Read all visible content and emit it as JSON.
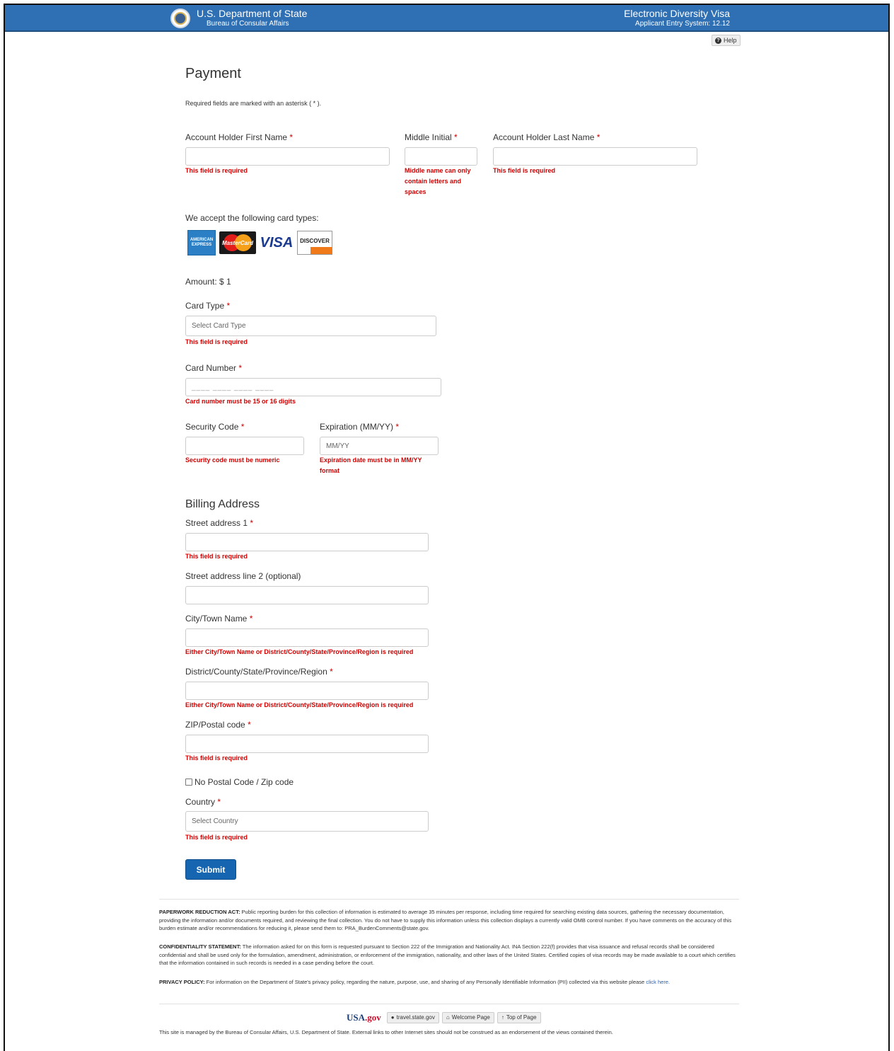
{
  "header": {
    "department": "U.S. Department of State",
    "bureau": "Bureau of Consular Affairs",
    "system_name": "Electronic Diversity Visa",
    "system_version": "Applicant Entry System: 12.12",
    "help_label": "Help"
  },
  "page": {
    "title": "Payment",
    "required_note": "Required fields are marked with an asterisk ( * )."
  },
  "name_fields": {
    "first_name_label": "Account Holder First Name",
    "first_name_error": "This field is required",
    "middle_initial_label": "Middle Initial",
    "middle_initial_error": "Middle name can only contain letters and spaces",
    "last_name_label": "Account Holder Last Name",
    "last_name_error": "This field is required"
  },
  "cards": {
    "accept_label": "We accept the following card types:",
    "amex_label": "AMERICAN EXPRESS",
    "mastercard_label": "MasterCard",
    "visa_label": "VISA",
    "discover_label": "DISCOVER"
  },
  "payment": {
    "amount": "Amount: $ 1",
    "card_type_label": "Card Type",
    "card_type_value": "Select Card Type",
    "card_type_error": "This field is required",
    "card_number_label": "Card Number",
    "card_number_mask": "____ ____ ____ ____",
    "card_number_error": "Card number must be 15 or 16 digits",
    "security_code_label": "Security Code",
    "security_code_error": "Security code must be numeric",
    "expiration_label": "Expiration (MM/YY)",
    "expiration_placeholder": "MM/YY",
    "expiration_error": "Expiration date must be in MM/YY format"
  },
  "billing": {
    "title": "Billing Address",
    "street1_label": "Street address 1",
    "street1_error": "This field is required",
    "street2_label": "Street address line 2 (optional)",
    "city_label": "City/Town Name",
    "city_error": "Either City/Town Name or District/County/State/Province/Region is required",
    "district_label": "District/County/State/Province/Region",
    "district_error": "Either City/Town Name or District/County/State/Province/Region is required",
    "zip_label": "ZIP/Postal code",
    "zip_error": "This field is required",
    "no_postal_label": "No Postal Code / Zip code",
    "country_label": "Country",
    "country_value": "Select Country",
    "country_error": "This field is required"
  },
  "submit_label": "Submit",
  "legal": {
    "paperwork_heading": "PAPERWORK REDUCTION ACT:",
    "paperwork_text": " Public reporting burden for this collection of information is estimated to average 35 minutes per response, including time required for searching existing data sources, gathering the necessary documentation, providing the information and/or documents required, and reviewing the final collection. You do not have to supply this information unless this collection displays a currently valid OMB control number. If you have comments on the accuracy of this burden estimate and/or recommendations for reducing it, please send them to: PRA_BurdenComments@state.gov.",
    "confidentiality_heading": "CONFIDENTIALITY STATEMENT:",
    "confidentiality_text": " The information asked for on this form is requested pursuant to Section 222 of the Immigration and Nationality Act. INA Section 222(f) provides that visa issuance and refusal records shall be considered confidential and shall be used only for the formulation, amendment, administration, or enforcement of the immigration, nationality, and other laws of the United States. Certified copies of visa records may be made available to a court which certifies that the information contained in such records is needed in a case pending before the court.",
    "privacy_heading": "PRIVACY POLICY:",
    "privacy_text": " For information on the Department of State's privacy policy, regarding the nature, purpose, use, and sharing of any Personally Identifiable Information (PII) collected via this website please ",
    "privacy_link": "click here."
  },
  "footer": {
    "usagov_prefix": "USA",
    "usagov_suffix": ".gov",
    "travel_label": "travel.state.gov",
    "welcome_label": "Welcome Page",
    "top_label": "Top of Page",
    "note": "This site is managed by the Bureau of Consular Affairs, U.S. Department of State. External links to other Internet sites should not be construed as an endorsement of the views contained therein."
  }
}
